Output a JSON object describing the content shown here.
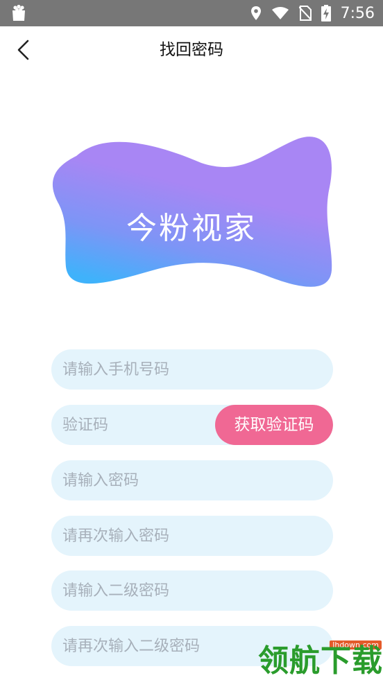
{
  "status_bar": {
    "time": "7:56"
  },
  "nav": {
    "title": "找回密码"
  },
  "logo": {
    "text": "今粉视家"
  },
  "form": {
    "phone_placeholder": "请输入手机号码",
    "code_placeholder": "验证码",
    "get_code_label": "获取验证码",
    "password_placeholder": "请输入密码",
    "password_confirm_placeholder": "请再次输入密码",
    "secondary_password_placeholder": "请输入二级密码",
    "secondary_password_confirm_placeholder": "请再次输入二级密码"
  },
  "watermark": {
    "url": "lhdown.com",
    "text": "领航下载"
  },
  "colors": {
    "status_bar": "#777777",
    "field_background": "#e4f4fc",
    "accent_pink": "#f06894",
    "logo_gradient_top": "#a886f4",
    "logo_gradient_bottom": "#3fb2fb",
    "watermark_green": "#2a9c2c"
  }
}
